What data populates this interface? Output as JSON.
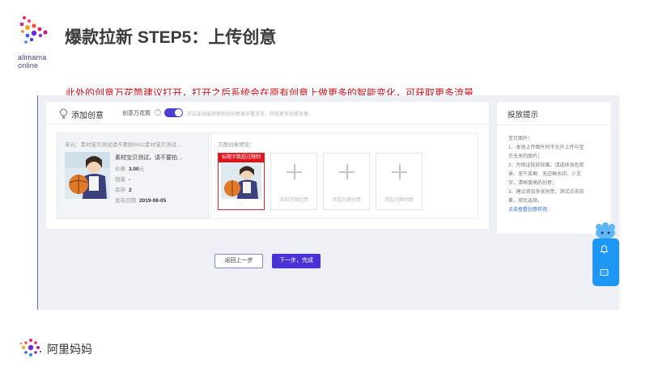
{
  "slide": {
    "title": "爆款拉新 STEP5：上传创意",
    "note": "此处的创意万花筒建议打开，打开之后系统会在原有创意上做更多的智能变化，可获取更多流量",
    "brand_line1": "alimama",
    "brand_line2": "online",
    "footer_logo_text": "阿里妈妈"
  },
  "panel": {
    "title": "添加创意",
    "kaleidoscope_label": "创意万花筒",
    "help_icon": "?",
    "kaleidoscope_on": true,
    "toggle_hint": "开启该功能将使您的创意更丰富多变，获取更多优质流量。"
  },
  "product": {
    "unit_line": "单元：素材宝贝测试请不要拍0422素材宝贝测试…",
    "name": "素材宝贝测试，请不要拍…",
    "price_label": "价格",
    "price_value": "3.00",
    "price_unit": "元",
    "sales_label": "销量",
    "sales_value": "-",
    "stock_label": "库存",
    "stock_value": "2",
    "date_label": "发布日期",
    "date_value": "2019-08-05"
  },
  "preview": {
    "title": "方图创意预览：",
    "banner_text": "标题字数超过限制",
    "empty_slot_label": "添加方图创意",
    "empty_slots": 3
  },
  "buttons": {
    "back": "返回上一步",
    "next": "下一步，完成"
  },
  "side": {
    "title": "投放提示",
    "tips": [
      "宝贝图片：",
      "1、本地上传图片时不允许上传与宝",
      "贝无关的图片；",
      "2、为保证投放效果，请选择浅色背",
      "景、无牛皮癣、无边框水印、少文",
      "字、清晰度高的创意；",
      "3、建议添加多张创意，测试点击效",
      "果，择优选择。"
    ],
    "link": "点击查看创意样例"
  },
  "colors": {
    "accent": "#4a33d6",
    "note_red": "#c8141e",
    "float_blue": "#1e96f3"
  }
}
